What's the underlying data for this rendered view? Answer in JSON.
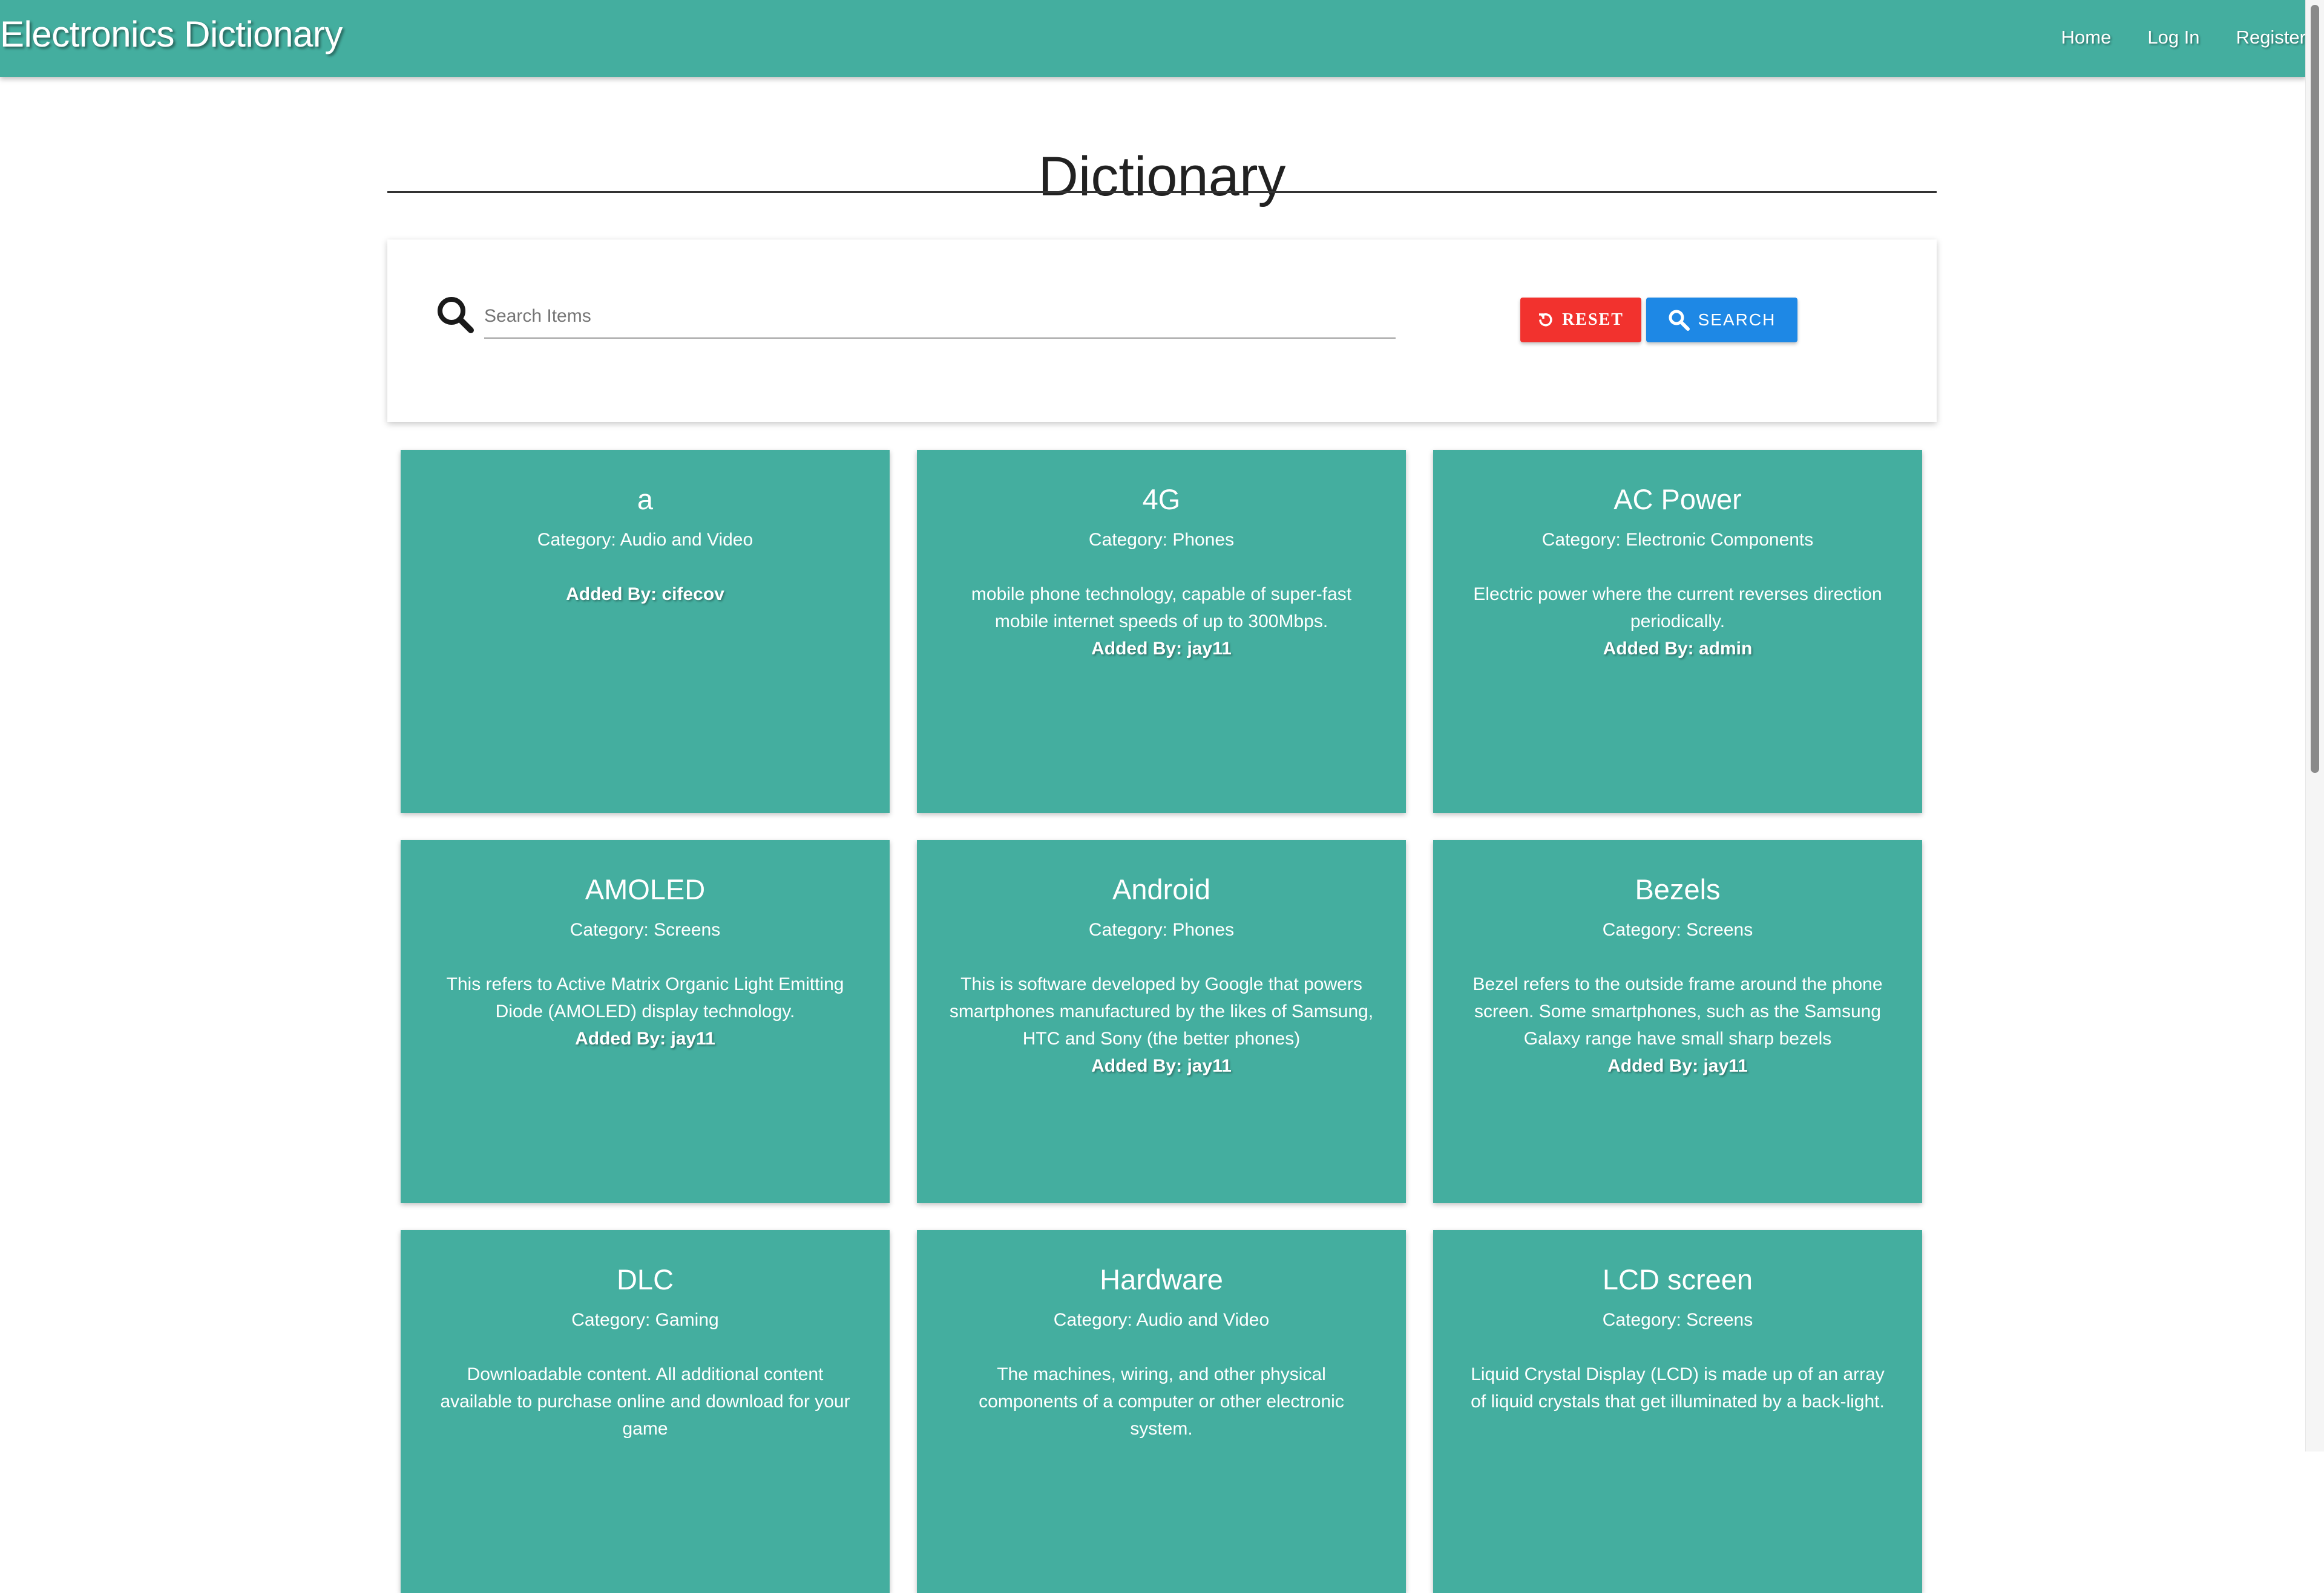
{
  "app": {
    "brand": "Electronics Dictionary"
  },
  "nav": {
    "links": [
      "Home",
      "Log In",
      "Register"
    ]
  },
  "page": {
    "title": "Dictionary"
  },
  "search": {
    "placeholder": "Search Items",
    "value": "",
    "reset_label": "RESET",
    "search_label": "SEARCH"
  },
  "colors": {
    "primary": "#44ae9f",
    "reset": "#f2322e",
    "search": "#1e88e5"
  },
  "icons": {
    "search": "search-icon",
    "reset": "reset-icon"
  },
  "cards": [
    {
      "title": "a",
      "category": "Category: Audio and Video",
      "description": "",
      "added_by": "Added By: cifecov"
    },
    {
      "title": "4G",
      "category": "Category: Phones",
      "description": "mobile phone technology, capable of super-fast mobile internet speeds of up to 300Mbps.",
      "added_by": "Added By: jay11"
    },
    {
      "title": "AC Power",
      "category": "Category: Electronic Components",
      "description": "Electric power where the current reverses direction periodically.",
      "added_by": "Added By: admin"
    },
    {
      "title": "AMOLED",
      "category": "Category: Screens",
      "description": "This refers to Active Matrix Organic Light Emitting Diode (AMOLED) display technology.",
      "added_by": "Added By: jay11"
    },
    {
      "title": "Android",
      "category": "Category: Phones",
      "description": "This is software developed by Google that powers smartphones manufactured by the likes of Samsung, HTC and Sony (the better phones)",
      "added_by": "Added By: jay11"
    },
    {
      "title": "Bezels",
      "category": "Category: Screens",
      "description": "Bezel refers to the outside frame around the phone screen. Some smartphones, such as the Samsung Galaxy range have small sharp bezels",
      "added_by": "Added By: jay11"
    },
    {
      "title": "DLC",
      "category": "Category: Gaming",
      "description": "Downloadable content. All additional content available to purchase online and download for your game",
      "added_by": ""
    },
    {
      "title": "Hardware",
      "category": "Category: Audio and Video",
      "description": "The machines, wiring, and other physical components of a computer or other electronic system.",
      "added_by": ""
    },
    {
      "title": "LCD screen",
      "category": "Category: Screens",
      "description": "Liquid Crystal Display (LCD) is made up of an array of liquid crystals that get illuminated by a back-light.",
      "added_by": ""
    }
  ]
}
